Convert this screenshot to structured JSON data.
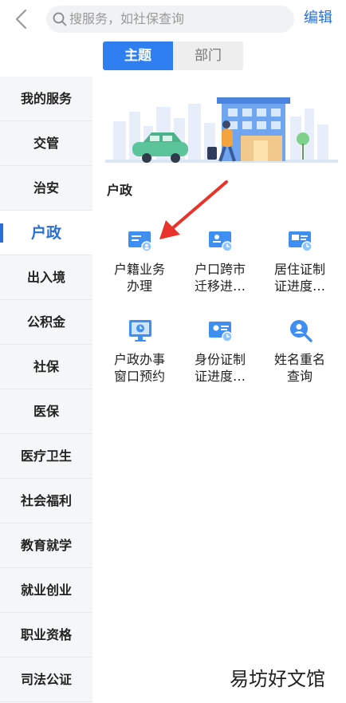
{
  "header": {
    "search_placeholder": "搜服务，如社保查询",
    "edit_label": "编辑"
  },
  "tabs": [
    {
      "label": "主题",
      "active": true
    },
    {
      "label": "部门",
      "active": false
    }
  ],
  "sidebar": {
    "items": [
      {
        "label": "我的服务"
      },
      {
        "label": "交管"
      },
      {
        "label": "治安"
      },
      {
        "label": "户政",
        "active": true
      },
      {
        "label": "出入境"
      },
      {
        "label": "公积金"
      },
      {
        "label": "社保"
      },
      {
        "label": "医保"
      },
      {
        "label": "医疗卫生"
      },
      {
        "label": "社会福利"
      },
      {
        "label": "教育就学"
      },
      {
        "label": "就业创业"
      },
      {
        "label": "职业资格"
      },
      {
        "label": "司法公证"
      }
    ]
  },
  "main": {
    "section_title": "户政",
    "services": [
      {
        "line1": "户籍业务",
        "line2": "办理",
        "icon": "household-register-icon"
      },
      {
        "line1": "户口跨市",
        "line2": "迁移进…",
        "icon": "household-transfer-icon"
      },
      {
        "line1": "居住证制",
        "line2": "证进度…",
        "icon": "residence-permit-icon"
      },
      {
        "line1": "户政办事",
        "line2": "窗口预约",
        "icon": "appointment-monitor-icon"
      },
      {
        "line1": "身份证制",
        "line2": "证进度…",
        "icon": "id-card-progress-icon"
      },
      {
        "line1": "姓名重名",
        "line2": "查询",
        "icon": "name-search-icon"
      }
    ]
  },
  "colors": {
    "accent": "#2a6fd8",
    "tab_active": "#2f7ff0",
    "annotation_arrow": "#e8332a"
  },
  "watermark": "易坊好文馆"
}
